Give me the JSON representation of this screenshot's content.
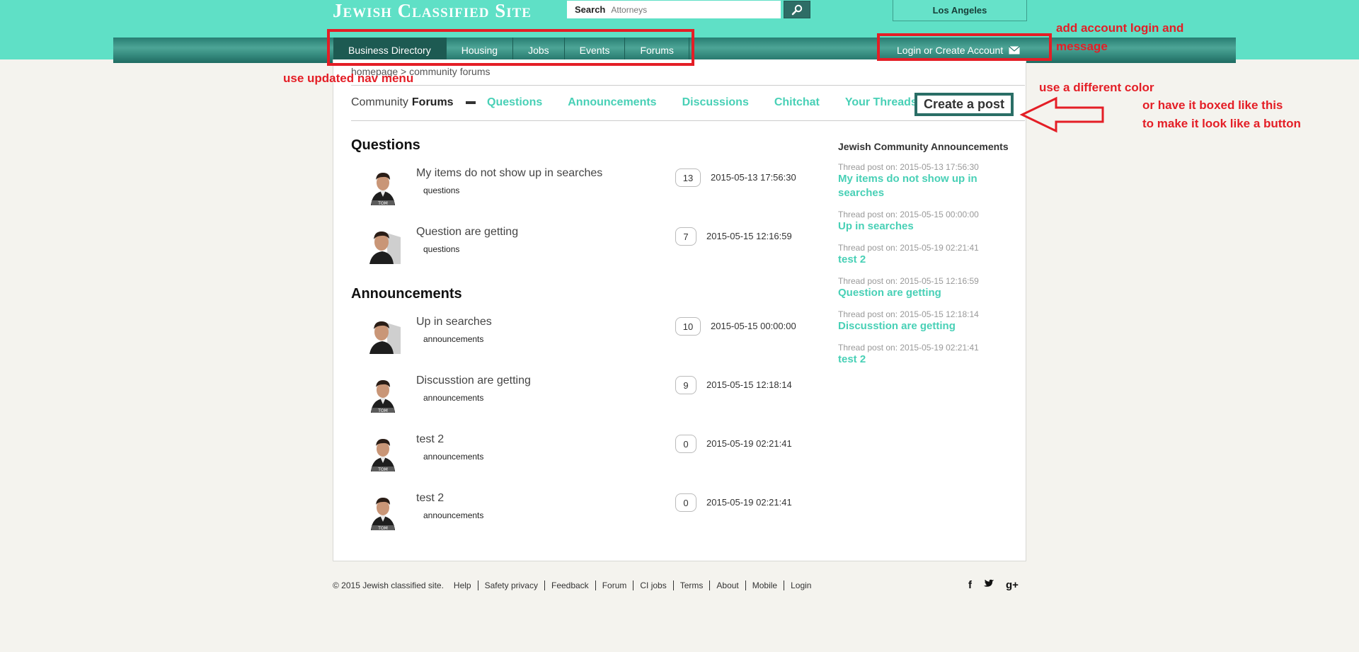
{
  "header": {
    "logo": "Jewish Classified Site",
    "search_label": "Search",
    "search_placeholder": "Attorneys",
    "location": "Los Angeles"
  },
  "nav": {
    "items": [
      "Business Directory",
      "Housing",
      "Jobs",
      "Events",
      "Forums"
    ],
    "active": "Business Directory",
    "login_label": "Login or Create Account"
  },
  "annotations": {
    "nav_note": "use updated nav menu",
    "login_note_line1": "add account login and",
    "login_note_line2": "message",
    "color_note": "use a different color",
    "box_note_line1": "or have it boxed like this",
    "box_note_line2": "to make it look like a button"
  },
  "breadcrumb": "homepage > community forums",
  "subnav": {
    "prefix": "Community",
    "bold": "Forums",
    "tabs": [
      "Questions",
      "Announcements",
      "Discussions",
      "Chitchat",
      "Your Threads"
    ],
    "create_post": "Create a post"
  },
  "sections": [
    {
      "heading": "Questions",
      "threads": [
        {
          "title": "My items do not show up in searches",
          "category": "questions",
          "count": "13",
          "time": "2015-05-13 17:56:30"
        },
        {
          "title": "Question are getting",
          "category": "questions",
          "count": "7",
          "time": "2015-05-15 12:16:59"
        }
      ]
    },
    {
      "heading": "Announcements",
      "threads": [
        {
          "title": "Up in searches",
          "category": "announcements",
          "count": "10",
          "time": "2015-05-15 00:00:00"
        },
        {
          "title": "Discusstion are getting",
          "category": "announcements",
          "count": "9",
          "time": "2015-05-15 12:18:14"
        },
        {
          "title": "test 2",
          "category": "announcements",
          "count": "0",
          "time": "2015-05-19 02:21:41"
        },
        {
          "title": "test 2",
          "category": "announcements",
          "count": "0",
          "time": "2015-05-19 02:21:41"
        }
      ]
    }
  ],
  "sidebar": {
    "heading": "Jewish Community Announcements",
    "items": [
      {
        "meta": "Thread post on: 2015-05-13 17:56:30",
        "title": "My items do not show up in searches"
      },
      {
        "meta": "Thread post on: 2015-05-15 00:00:00",
        "title": "Up in searches"
      },
      {
        "meta": "Thread post on: 2015-05-19 02:21:41",
        "title": "test 2"
      },
      {
        "meta": "Thread post on: 2015-05-15 12:16:59",
        "title": "Question are getting"
      },
      {
        "meta": "Thread post on: 2015-05-15 12:18:14",
        "title": "Discusstion are getting"
      },
      {
        "meta": "Thread post on: 2015-05-19 02:21:41",
        "title": "test 2"
      }
    ]
  },
  "footer": {
    "copyright": "© 2015 Jewish classified site.",
    "links": [
      "Help",
      "Safety privacy",
      "Feedback",
      "Forum",
      "CI jobs",
      "Terms",
      "About",
      "Mobile",
      "Login"
    ],
    "social": [
      "f",
      "t",
      "g+"
    ]
  },
  "colors": {
    "brand_teal": "#5fe0c6",
    "nav_dark": "#1d5a52",
    "link_teal": "#48d0b6",
    "annotation_red": "#e41e26"
  }
}
